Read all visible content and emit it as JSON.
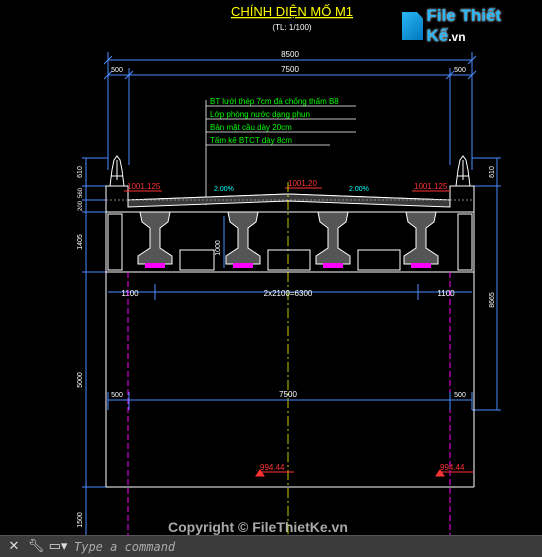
{
  "title": "CHÍNH DIỆN MỐ M1",
  "scale": "(TL: 1/100)",
  "logo": {
    "name": "File Thiết Kế",
    "domain": ".vn"
  },
  "watermark": "Copyright © FileThietKe.vn",
  "dims": {
    "total_width": "8500",
    "inner_width": "7500",
    "left_edge": "500",
    "right_edge": "500",
    "spacing": "2x2100=6300",
    "left_offset": "1100",
    "right_offset": "1100",
    "lower_inner": "7500",
    "lower_left": "500",
    "lower_right": "500",
    "left_610": "610",
    "right_610": "610",
    "left_200": "200",
    "left_560": "560",
    "left_1405": "1405",
    "left_5000": "5000",
    "left_1500": "1500",
    "right_8665": "8665",
    "girder_1000": "1000"
  },
  "elevations": {
    "left": "1001.125",
    "center": "1001.20",
    "right": "1001.125",
    "foot_left": "994.44",
    "foot_right": "994.44"
  },
  "slopes": {
    "left": "2.00%",
    "right": "2.00%"
  },
  "layers": [
    "BT lưới thép 7cm đá chống thấm B8",
    "Lớp phòng nước dạng phun",
    "Bản mặt cầu dày 20cm",
    "Tấm kê BTCT dày 8cm"
  ],
  "command": {
    "placeholder": "Type a command"
  },
  "colors": {
    "background": "#000000",
    "title": "#ffff00",
    "dimension": "#4a8cff",
    "structure": "#ffffff",
    "centerline": "#ff00ff",
    "elevation": "#ff3333",
    "slope": "#00ffff",
    "annotation": "#00ff00"
  }
}
